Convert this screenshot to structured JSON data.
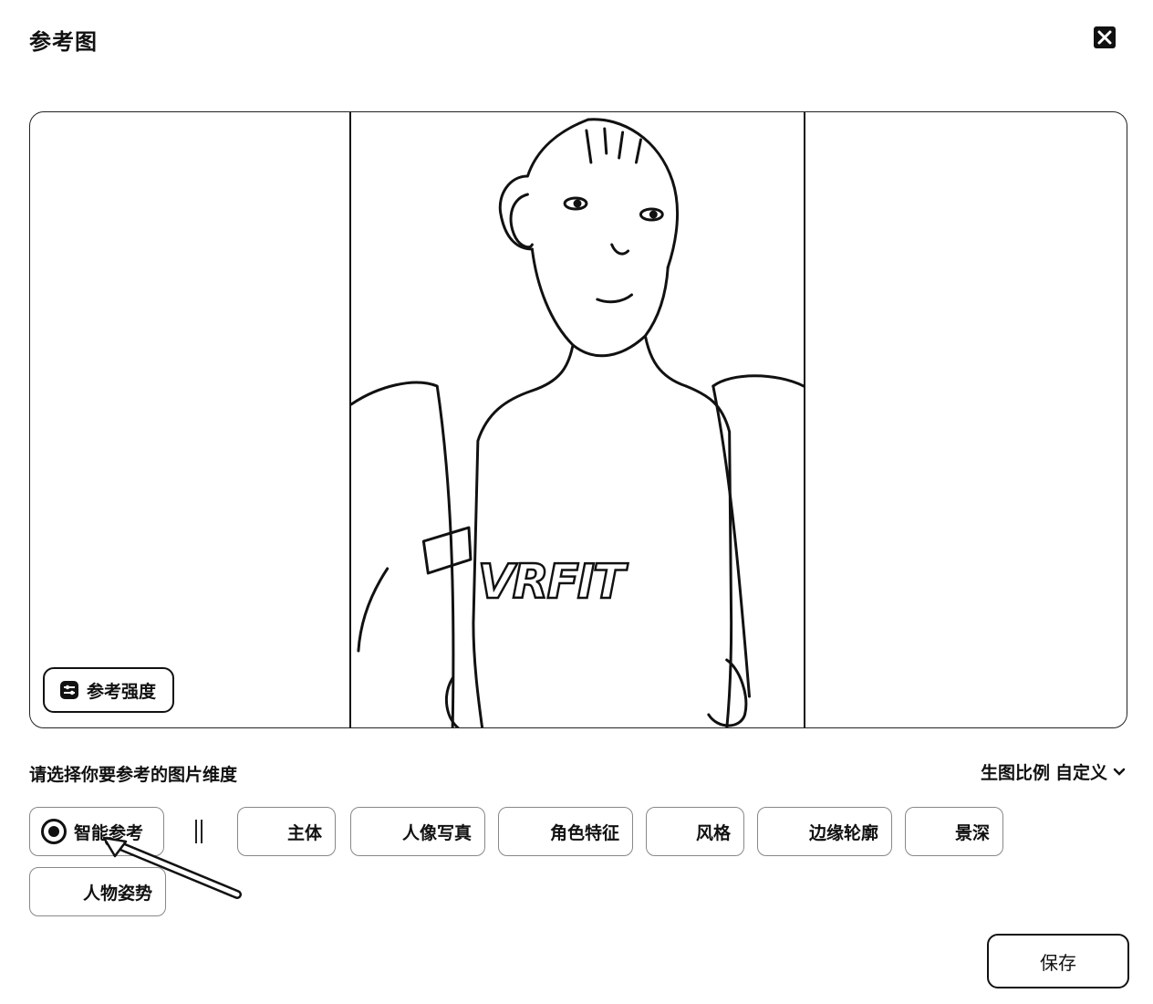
{
  "dialog": {
    "title": "参考图"
  },
  "preview": {
    "strength_label": "参考强度"
  },
  "dimension": {
    "prompt": "请选择你要参考的图片维度",
    "ratio_label": "生图比例",
    "ratio_value": "自定义",
    "options": [
      {
        "label": "智能参考",
        "selected": true
      },
      {
        "label": "主体"
      },
      {
        "label": "人像写真"
      },
      {
        "label": "角色特征"
      },
      {
        "label": "风格"
      },
      {
        "label": "边缘轮廓"
      },
      {
        "label": "景深"
      },
      {
        "label": "人物姿势"
      }
    ]
  },
  "footer": {
    "save_label": "保存"
  },
  "image": {
    "shirt_text": "VRFIT"
  },
  "icons": {
    "close": "close-icon",
    "settings": "sliders-icon",
    "dropdown": "chevron-down-icon",
    "radio": "radio-selected-icon"
  }
}
